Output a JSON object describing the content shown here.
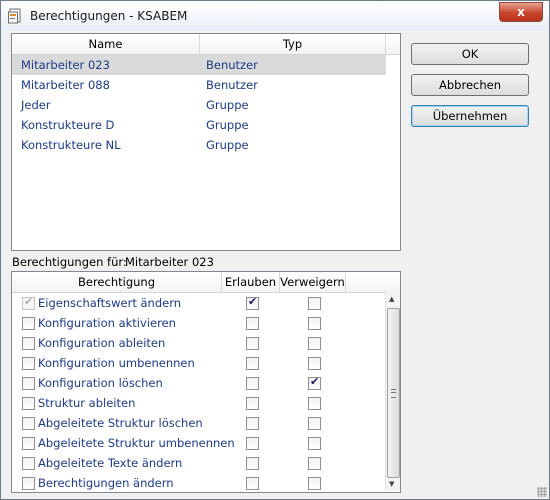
{
  "window": {
    "title": "Berechtigungen - KSABEM",
    "close_label": "x"
  },
  "principals": {
    "columns": [
      "Name",
      "Typ"
    ],
    "rows": [
      {
        "name": "Mitarbeiter 023",
        "type": "Benutzer",
        "selected": true
      },
      {
        "name": "Mitarbeiter 088",
        "type": "Benutzer",
        "selected": false
      },
      {
        "name": "Jeder",
        "type": "Gruppe",
        "selected": false
      },
      {
        "name": "Konstrukteure D",
        "type": "Gruppe",
        "selected": false
      },
      {
        "name": "Konstrukteure NL",
        "type": "Gruppe",
        "selected": false
      }
    ]
  },
  "permissions_for": {
    "label": "Berechtigungen für:",
    "user": "Mitarbeiter 023"
  },
  "permissions": {
    "columns": [
      "Berechtigung",
      "Erlauben",
      "Verweigern"
    ],
    "rows": [
      {
        "name": "Eigenschaftswert ändern",
        "enabled": false,
        "allow": true,
        "deny": false
      },
      {
        "name": "Konfiguration aktivieren",
        "enabled": true,
        "allow": false,
        "deny": false
      },
      {
        "name": "Konfiguration ableiten",
        "enabled": true,
        "allow": false,
        "deny": false
      },
      {
        "name": "Konfiguration umbenennen",
        "enabled": true,
        "allow": false,
        "deny": false
      },
      {
        "name": "Konfiguration löschen",
        "enabled": true,
        "allow": false,
        "deny": true
      },
      {
        "name": "Struktur ableiten",
        "enabled": true,
        "allow": false,
        "deny": false
      },
      {
        "name": "Abgeleitete Struktur löschen",
        "enabled": true,
        "allow": false,
        "deny": false
      },
      {
        "name": "Abgeleitete Struktur umbenennen",
        "enabled": true,
        "allow": false,
        "deny": false
      },
      {
        "name": "Abgeleitete Texte ändern",
        "enabled": true,
        "allow": false,
        "deny": false
      },
      {
        "name": "Berechtigungen ändern",
        "enabled": true,
        "allow": false,
        "deny": false
      }
    ]
  },
  "buttons": {
    "ok": "OK",
    "cancel": "Abbrechen",
    "apply": "Übernehmen"
  },
  "colors": {
    "link_text": "#1c3a8a",
    "selection": "#dadada",
    "close_red": "#c7452b"
  }
}
